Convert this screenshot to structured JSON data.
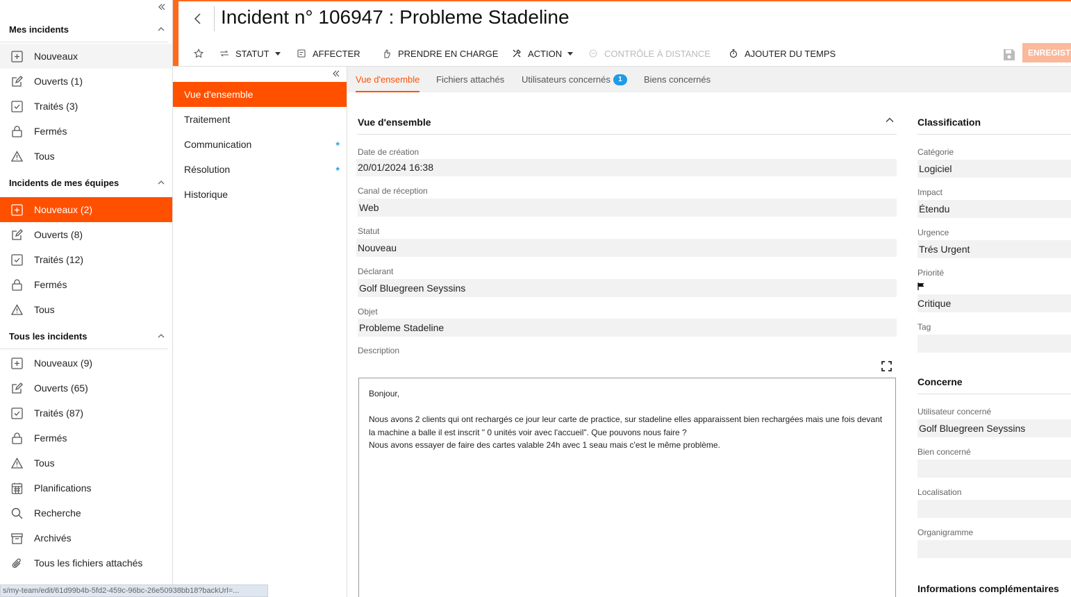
{
  "sidebar": {
    "groups": [
      {
        "title": "Mes incidents",
        "items": [
          {
            "label": "Nouveaux",
            "icon": "plus-square-icon"
          },
          {
            "label": "Ouverts (1)",
            "icon": "edit-icon"
          },
          {
            "label": "Traités (3)",
            "icon": "check-square-icon"
          },
          {
            "label": "Fermés",
            "icon": "lock-icon"
          },
          {
            "label": "Tous",
            "icon": "warning-icon"
          }
        ]
      },
      {
        "title": "Incidents de mes équipes",
        "items": [
          {
            "label": "Nouveaux (2)",
            "icon": "plus-square-icon"
          },
          {
            "label": "Ouverts (8)",
            "icon": "edit-icon"
          },
          {
            "label": "Traités (12)",
            "icon": "check-square-icon"
          },
          {
            "label": "Fermés",
            "icon": "lock-icon"
          },
          {
            "label": "Tous",
            "icon": "warning-icon"
          }
        ]
      },
      {
        "title": "Tous les incidents",
        "items": [
          {
            "label": "Nouveaux (9)",
            "icon": "plus-square-icon"
          },
          {
            "label": "Ouverts (65)",
            "icon": "edit-icon"
          },
          {
            "label": "Traités (87)",
            "icon": "check-square-icon"
          },
          {
            "label": "Fermés",
            "icon": "lock-icon"
          },
          {
            "label": "Tous",
            "icon": "warning-icon"
          },
          {
            "label": "Planifications",
            "icon": "calendar-icon"
          },
          {
            "label": "Recherche",
            "icon": "search-icon"
          },
          {
            "label": "Archivés",
            "icon": "archive-icon"
          },
          {
            "label": "Tous les fichiers attachés",
            "icon": "paperclip-icon"
          }
        ]
      }
    ]
  },
  "header": {
    "title": "Incident n° 106947 : Probleme Stadeline",
    "toolbar": {
      "statut": "STATUT",
      "affecter": "AFFECTER",
      "prendre": "PRENDRE EN CHARGE",
      "action": "ACTION",
      "controle": "CONTRÔLE À DISTANCE",
      "ajouter": "AJOUTER DU TEMPS",
      "enregistrer": "ENREGISTRER"
    }
  },
  "secnav": {
    "items": [
      "Vue d'ensemble",
      "Traitement",
      "Communication",
      "Résolution",
      "Historique"
    ],
    "required_mark": "*"
  },
  "tabs": {
    "overview": "Vue d'ensemble",
    "files": "Fichiers attachés",
    "users": "Utilisateurs concernés",
    "users_count": "1",
    "assets": "Biens concernés"
  },
  "overview": {
    "heading": "Vue d'ensemble",
    "date_label": "Date de création",
    "date_value": "20/01/2024 16:38",
    "canal_label": "Canal de réception",
    "canal_value": "Web",
    "statut_label": "Statut",
    "statut_value": "Nouveau",
    "declarant_label": "Déclarant",
    "declarant_value": "Golf Bluegreen Seyssins",
    "objet_label": "Objet",
    "objet_value": "Probleme Stadeline",
    "description_label": "Description",
    "description_lines": [
      "Bonjour,",
      "",
      "Nous avons 2 clients qui ont rechargés ce jour leur carte de practice, sur stadeline elles apparaissent bien rechargées mais une fois devant la machine a balle il est inscrit \" 0 unités voir avec l'accueil\". Que pouvons nous faire ?",
      "Nous avons essayer de faire des cartes valable 24h avec 1 seau mais c'est le même problème."
    ]
  },
  "classification": {
    "heading": "Classification",
    "categorie_label": "Catégorie",
    "categorie_value": "Logiciel",
    "impact_label": "Impact",
    "impact_value": "Étendu",
    "urgence_label": "Urgence",
    "urgence_value": "Trés Urgent",
    "priorite_label": "Priorité",
    "priorite_value": "Critique",
    "tag_label": "Tag",
    "tag_value": ""
  },
  "concerne": {
    "heading": "Concerne",
    "utilisateur_label": "Utilisateur concerné",
    "utilisateur_value": "Golf Bluegreen Seyssins",
    "bien_label": "Bien concerné",
    "bien_value": "",
    "localisation_label": "Localisation",
    "localisation_value": "",
    "organigramme_label": "Organigramme",
    "organigramme_value": ""
  },
  "infos_heading": "Informations complémentaires",
  "status_url": "s/my-team/edit/61d99b4b-5fd2-459c-96bc-26e50938bb18?backUrl=...",
  "colors": {
    "accent": "#ff5000",
    "badge": "#1e9be8"
  }
}
